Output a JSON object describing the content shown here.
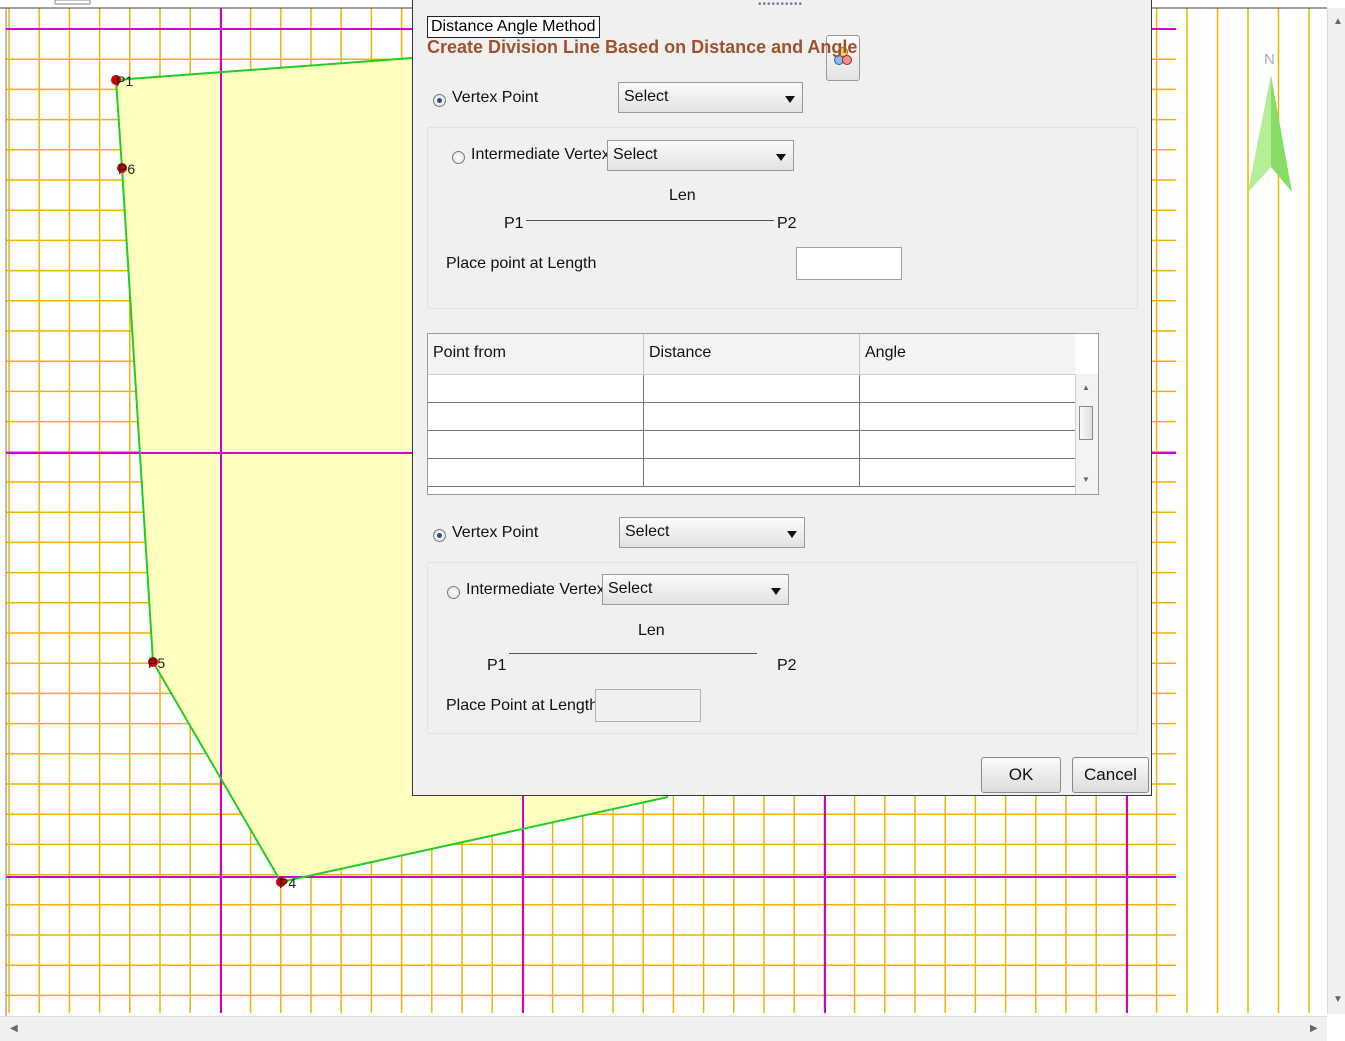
{
  "map": {
    "points": [
      {
        "label": "P1"
      },
      {
        "label": "P6"
      },
      {
        "label": "P5"
      },
      {
        "label": "P4"
      }
    ],
    "north_label": "N",
    "colors": {
      "grid_minor": "#f0b400",
      "grid_major": "#d000d0",
      "polygon_fill": "#ffffc0",
      "polygon_edge": "#22cc22",
      "north_arrow": "#88dd66",
      "vertex": "#cc0000"
    }
  },
  "dialog": {
    "tooltip": "Distance Angle Method",
    "subtitle": "Create Division Line Based on Distance and Angle",
    "section1": {
      "vertex_label": "Vertex Point",
      "vertex_value": "Select",
      "intermediate_label": "Intermediate Vertex",
      "intermediate_value": "Select",
      "len_label": "Len",
      "p1": "P1",
      "p2": "P2",
      "place_label": "Place point at Length",
      "place_value": ""
    },
    "table": {
      "columns": [
        "Point from",
        "Distance",
        "Angle"
      ],
      "rows": [
        [
          "",
          "",
          ""
        ],
        [
          "",
          "",
          ""
        ],
        [
          "",
          "",
          ""
        ],
        [
          "",
          "",
          ""
        ]
      ]
    },
    "section2": {
      "vertex_label": "Vertex Point",
      "vertex_value": "Select",
      "intermediate_label": "Intermediate Vertex",
      "intermediate_value": "Select",
      "len_label": "Len",
      "p1": "P1",
      "p2": "P2",
      "place_label": "Place Point at Length",
      "place_value": ""
    },
    "ok_label": "OK",
    "cancel_label": "Cancel"
  }
}
